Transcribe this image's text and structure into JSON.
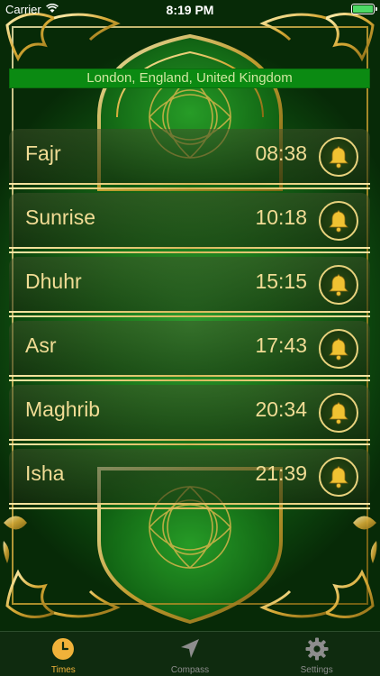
{
  "status_bar": {
    "carrier": "Carrier",
    "time": "8:19 PM",
    "battery_level": 1.0
  },
  "location": "London, England, United Kingdom",
  "prayers": [
    {
      "name": "Fajr",
      "time": "08:38",
      "icon": "bell-icon"
    },
    {
      "name": "Sunrise",
      "time": "10:18",
      "icon": "bell-icon"
    },
    {
      "name": "Dhuhr",
      "time": "15:15",
      "icon": "bell-icon"
    },
    {
      "name": "Asr",
      "time": "17:43",
      "icon": "bell-icon"
    },
    {
      "name": "Maghrib",
      "time": "20:34",
      "icon": "bell-icon"
    },
    {
      "name": "Isha",
      "time": "21:39",
      "icon": "bell-icon"
    }
  ],
  "tabs": [
    {
      "label": "Times",
      "icon": "clock-icon",
      "active": true
    },
    {
      "label": "Compass",
      "icon": "compass-arrow-icon",
      "active": false
    },
    {
      "label": "Settings",
      "icon": "gear-icon",
      "active": false
    }
  ],
  "colors": {
    "background_green": "#1c7a1c",
    "gold": "#f1dc95",
    "banner_green": "#0b8a12",
    "active_tab": "#f0b23a",
    "inactive_tab": "#8d8d8d"
  }
}
